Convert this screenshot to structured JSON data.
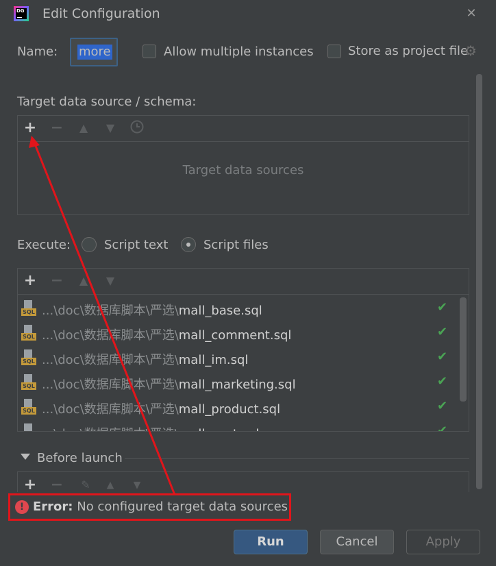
{
  "window": {
    "title": "Edit Configuration",
    "app_icon": "datagrip-logo",
    "app_icon_text": "DG"
  },
  "name_row": {
    "label": "Name:",
    "value": "more",
    "allow_multiple": {
      "label": "Allow multiple instances",
      "checked": false
    },
    "store_project": {
      "label": "Store as project file",
      "checked": false
    }
  },
  "target": {
    "label": "Target data source / schema:",
    "empty_text": "Target data sources",
    "toolbar_icons": [
      "plus-icon",
      "minus-icon",
      "up-icon",
      "down-icon",
      "history-icon"
    ]
  },
  "execute": {
    "label": "Execute:",
    "options": [
      {
        "label": "Script text",
        "selected": false
      },
      {
        "label": "Script files",
        "selected": true
      }
    ]
  },
  "files": {
    "toolbar_icons": [
      "plus-icon",
      "minus-icon",
      "up-icon",
      "down-icon"
    ],
    "icon_badge": "SQL",
    "items": [
      {
        "prefix": "...\\doc\\数据库脚本\\严选\\",
        "name": "mall_base.sql"
      },
      {
        "prefix": "...\\doc\\数据库脚本\\严选\\",
        "name": "mall_comment.sql"
      },
      {
        "prefix": "...\\doc\\数据库脚本\\严选\\",
        "name": "mall_im.sql"
      },
      {
        "prefix": "...\\doc\\数据库脚本\\严选\\",
        "name": "mall_marketing.sql"
      },
      {
        "prefix": "...\\doc\\数据库脚本\\严选\\",
        "name": "mall_product.sql"
      },
      {
        "prefix": "...\\doc\\数据库脚本\\严选\\",
        "name": "mall_seat.sql"
      }
    ]
  },
  "before_launch": {
    "label": "Before launch"
  },
  "error": {
    "prefix": "Error:",
    "message": "No configured target data sources"
  },
  "buttons": {
    "run": "Run",
    "cancel": "Cancel",
    "apply": "Apply"
  },
  "colors": {
    "background": "#3c3f41",
    "accent": "#365880",
    "error_highlight": "#e0151b",
    "success_check": "#4aa354"
  }
}
